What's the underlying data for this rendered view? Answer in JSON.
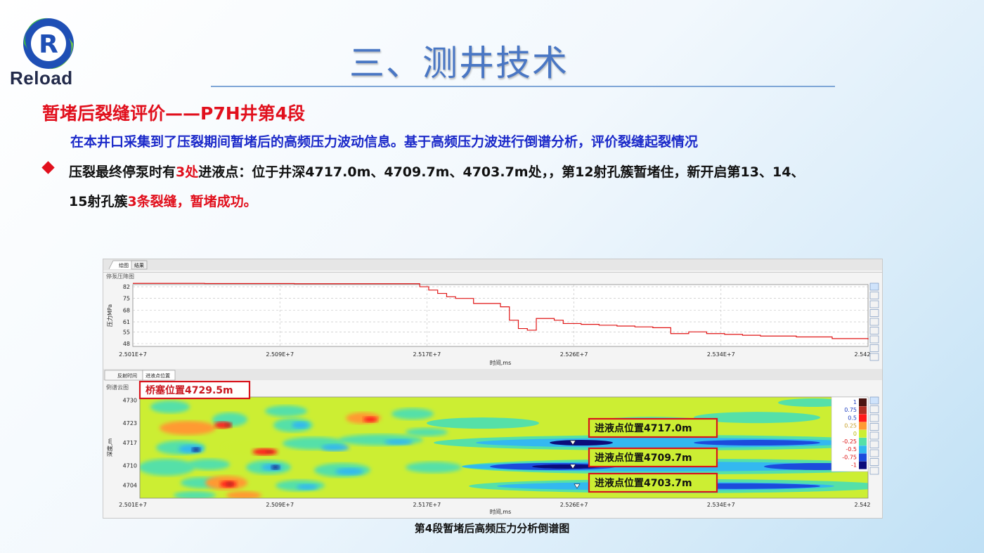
{
  "logo": {
    "letter": "R",
    "text": "Reload"
  },
  "slide_title": "三、测井技术",
  "section_heading": "暂堵后裂缝评价——P7H井第4段",
  "intro": "在本井口采集到了压裂期间暂堵后的高频压力波动信息。基于高频压力波进行倒谱分析，评价裂缝起裂情况",
  "bullet": {
    "p1": "压裂最终停泵时有",
    "p2": "3处",
    "p3": "进液点：位于井深4717.0m、4709.7m、4703.7m处，，第12射孔簇暂堵住，新开启第13、14、",
    "p4": "15射孔簇",
    "p5": "3条裂缝，暂堵成功。"
  },
  "figure_window": {
    "top_tabs": [
      "绘图",
      "结果"
    ],
    "top_panel_title": "停泵压降图",
    "bottom_tabs": [
      "反射时间",
      "进液点位置"
    ],
    "bottom_panel_title": "倒谱云图"
  },
  "chart_data": [
    {
      "type": "line",
      "title": "停泵压降图",
      "xlabel": "时间,ms",
      "ylabel": "压力MPa",
      "x_ticks": [
        "2.501E+7",
        "2.509E+7",
        "2.517E+7",
        "2.526E+7",
        "2.534E+7",
        "2.542"
      ],
      "y_ticks": [
        82,
        75,
        68,
        61,
        55,
        48
      ],
      "xlim": [
        25010000,
        25420000
      ],
      "ylim": [
        48,
        82
      ],
      "grid": true,
      "series": [
        {
          "color": "#e01515",
          "x": [
            25010000,
            25050000,
            25100000,
            25130000,
            25165000,
            25170000,
            25175000,
            25180000,
            25185000,
            25190000,
            25200000,
            25210000,
            25215000,
            25220000,
            25225000,
            25230000,
            25235000,
            25240000,
            25245000,
            25250000,
            25260000,
            25270000,
            25280000,
            25290000,
            25300000,
            25310000,
            25320000,
            25330000,
            25340000,
            25350000,
            25360000,
            25380000,
            25400000,
            25420000
          ],
          "y": [
            84,
            83.9,
            83.8,
            83.8,
            83.8,
            82,
            80,
            78,
            76,
            75,
            72,
            72,
            70,
            62,
            57,
            56,
            63,
            63,
            62,
            60,
            59.5,
            59,
            58.5,
            58,
            57.5,
            54,
            55,
            54,
            53.5,
            53,
            52.5,
            52,
            51,
            50.5
          ]
        }
      ]
    },
    {
      "type": "heatmap",
      "title": "倒谱云图",
      "xlabel": "时间,ms",
      "ylabel": "深度,m",
      "x_ticks": [
        "2.501E+7",
        "2.509E+7",
        "2.517E+7",
        "2.526E+7",
        "2.534E+7",
        "2.542"
      ],
      "y_ticks": [
        4730,
        4723,
        4717,
        4710,
        4704
      ],
      "colorbar": {
        "levels": [
          "1",
          "0.75",
          "0.5",
          "0.25",
          "0",
          "-0.25",
          "-0.5",
          "-0.75",
          "-1"
        ],
        "colors": [
          "#4a1410",
          "#b02f23",
          "#ff1a1a",
          "#ff9a33",
          "#ccee33",
          "#55e0a8",
          "#33b8f0",
          "#1c4bdc",
          "#0c0c7a"
        ]
      },
      "annotations": [
        {
          "label": "桥塞位置4729.5m",
          "depth": 4729.5
        },
        {
          "label": "进液点位置4717.0m",
          "depth": 4717.0
        },
        {
          "label": "进液点位置4709.7m",
          "depth": 4709.7
        },
        {
          "label": "进液点位置4703.7m",
          "depth": 4703.7
        }
      ]
    }
  ],
  "figure_caption": "第4段暂堵后高频压力分析倒谱图"
}
